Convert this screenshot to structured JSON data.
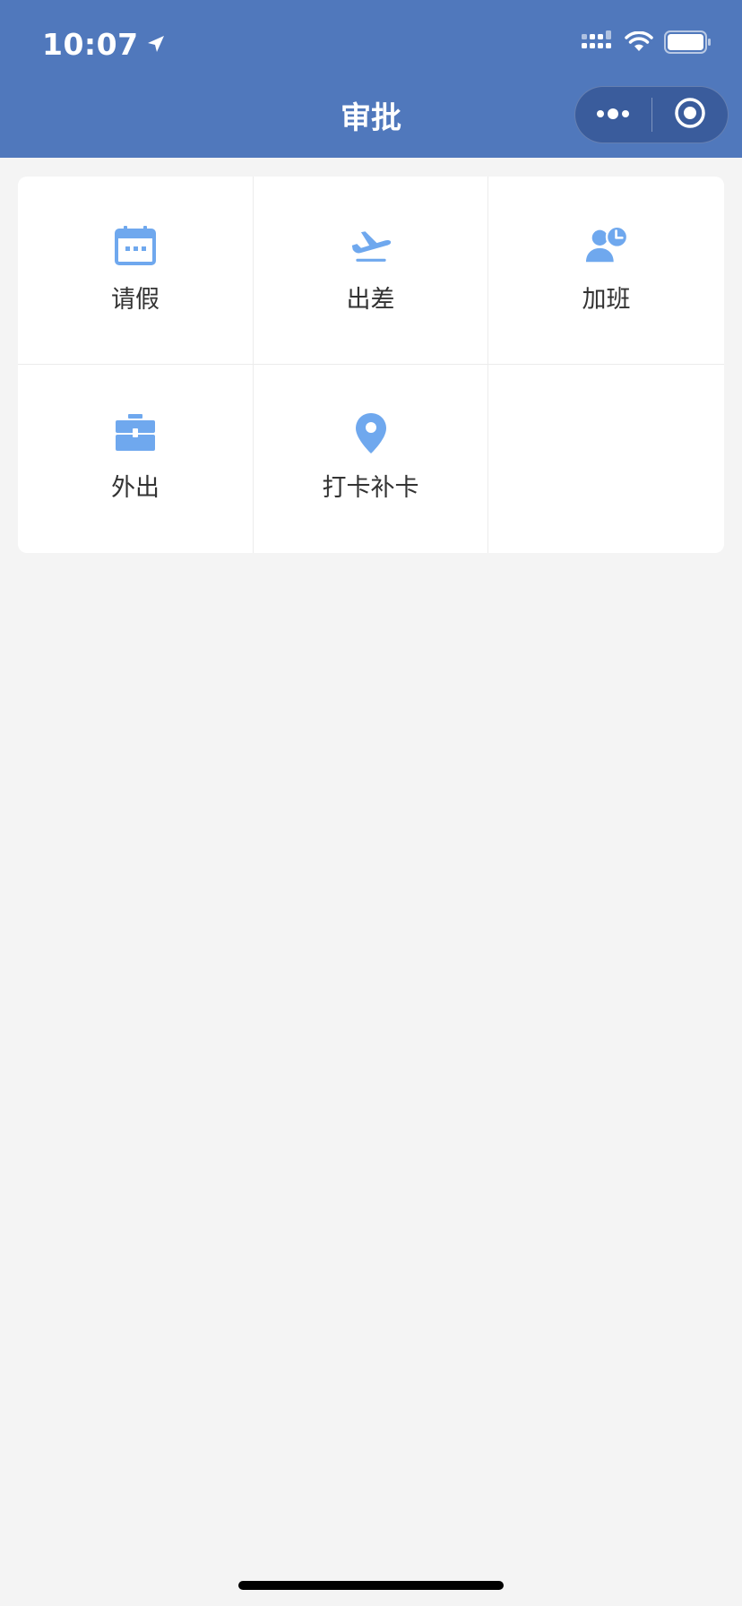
{
  "status_bar": {
    "time": "10:07"
  },
  "nav": {
    "title": "审批"
  },
  "grid": {
    "items": [
      {
        "label": "请假",
        "icon": "calendar-icon"
      },
      {
        "label": "出差",
        "icon": "airplane-takeoff-icon"
      },
      {
        "label": "加班",
        "icon": "user-clock-icon"
      },
      {
        "label": "外出",
        "icon": "briefcase-icon"
      },
      {
        "label": "打卡补卡",
        "icon": "location-pin-icon"
      }
    ]
  },
  "colors": {
    "header": "#5078bc",
    "icon": "#6fa8ee",
    "background": "#f4f4f4",
    "card": "#ffffff",
    "text": "#333333"
  }
}
